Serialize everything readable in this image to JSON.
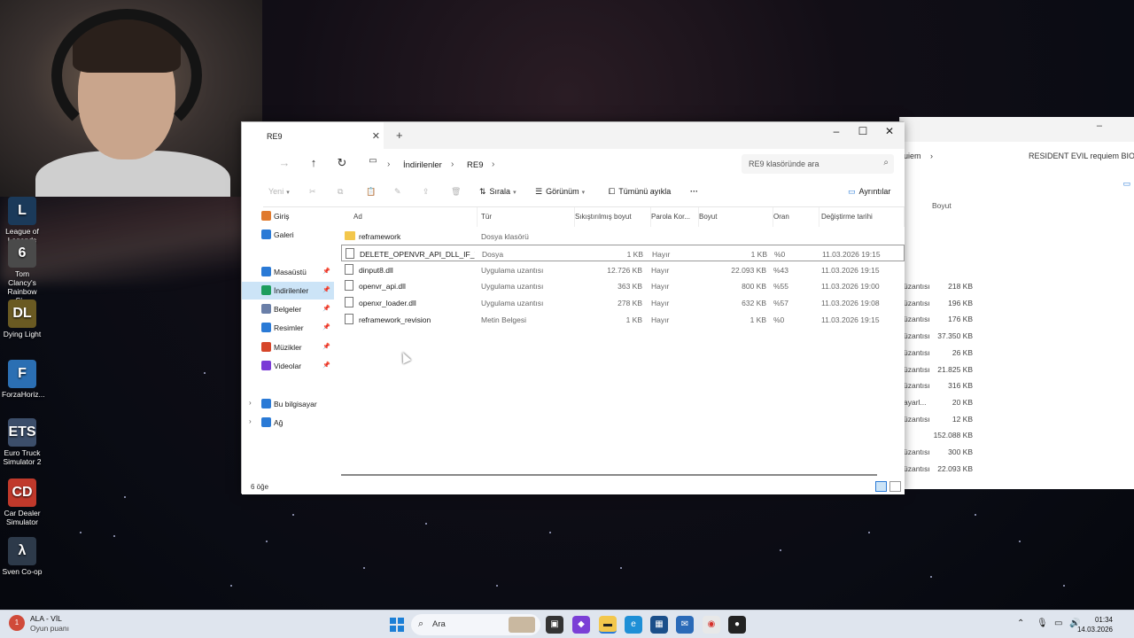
{
  "desktop": {
    "icons": [
      {
        "label": "League of Legends",
        "icon": "league-of-legends-icon",
        "color": "#1b3a5a",
        "glyph": "L"
      },
      {
        "label": "Tom Clancy's Rainbow Si...",
        "icon": "rainbow-six-icon",
        "color": "#4a4a4a",
        "glyph": "6"
      },
      {
        "label": "Dying Light",
        "icon": "dying-light-icon",
        "color": "#6a5a22",
        "glyph": "DL"
      },
      {
        "label": "ForzaHoriz...",
        "icon": "forza-horizon-icon",
        "color": "#2b6fb3",
        "glyph": "F"
      },
      {
        "label": "Euro Truck Simulator 2",
        "icon": "euro-truck-icon",
        "color": "#3c4e6a",
        "glyph": "ETS"
      },
      {
        "label": "Car Dealer Simulator",
        "icon": "car-dealer-icon",
        "color": "#c0392b",
        "glyph": "CD"
      },
      {
        "label": "Sven Co-op",
        "icon": "sven-coop-icon",
        "color": "#2d3a4a",
        "glyph": "λ"
      }
    ]
  },
  "bg_window": {
    "breadcrumb_tail": "uiem",
    "breadcrumb_next": "RESIDENT EVIL requiem BIOH",
    "col_size": "Boyut",
    "rows": [
      {
        "type": "üzantısı",
        "size": "218 KB"
      },
      {
        "type": "üzantısı",
        "size": "196 KB"
      },
      {
        "type": "üzantısı",
        "size": "176 KB"
      },
      {
        "type": "üzantısı",
        "size": "37.350 KB"
      },
      {
        "type": "üzantısı",
        "size": "26 KB"
      },
      {
        "type": "üzantısı",
        "size": "21.825 KB"
      },
      {
        "type": "üzantısı",
        "size": "316 KB"
      },
      {
        "type": "ayarl...",
        "size": "20 KB"
      },
      {
        "type": "üzantısı",
        "size": "12 KB"
      },
      {
        "type": "",
        "size": "152.088 KB"
      },
      {
        "type": "üzantısı",
        "size": "300 KB"
      },
      {
        "type": "üzantısı",
        "size": "22.093 KB"
      }
    ]
  },
  "explorer": {
    "tab_title": "RE9",
    "new_tab": "+",
    "breadcrumb": [
      "İndirilenler",
      "RE9"
    ],
    "search_placeholder": "RE9 klasöründe ara",
    "toolbar": {
      "new": "Yeni",
      "sort": "Sırala",
      "view": "Görünüm",
      "select_none": "Tümünü ayıkla",
      "more": "···",
      "details": "Ayrıntılar"
    },
    "sidebar": [
      {
        "label": "Giriş",
        "icon": "home-icon",
        "color": "#e07a2e",
        "pinned": false
      },
      {
        "label": "Galeri",
        "icon": "gallery-icon",
        "color": "#2a7ad6",
        "pinned": false
      },
      {
        "label": "Masaüstü",
        "icon": "desktop-icon",
        "color": "#2a7ad6",
        "pinned": true
      },
      {
        "label": "İndirilenler",
        "icon": "downloads-icon",
        "color": "#1e9e5e",
        "pinned": true,
        "selected": true
      },
      {
        "label": "Belgeler",
        "icon": "documents-icon",
        "color": "#6a7fa8",
        "pinned": true
      },
      {
        "label": "Resimler",
        "icon": "pictures-icon",
        "color": "#2a7ad6",
        "pinned": true
      },
      {
        "label": "Müzikler",
        "icon": "music-icon",
        "color": "#d6462a",
        "pinned": true
      },
      {
        "label": "Videolar",
        "icon": "videos-icon",
        "color": "#7a3ad6",
        "pinned": true
      },
      {
        "label": "Bu bilgisayar",
        "icon": "this-pc-icon",
        "color": "#2a7ad6",
        "pinned": false
      },
      {
        "label": "Ağ",
        "icon": "network-icon",
        "color": "#2a7ad6",
        "pinned": false
      }
    ],
    "columns": [
      "Ad",
      "Tür",
      "Sıkıştırılmış boyut",
      "Parola Kor...",
      "Boyut",
      "Oran",
      "Değiştirme tarihi"
    ],
    "files": [
      {
        "name": "reframework",
        "type": "Dosya klasörü",
        "compressed": "",
        "password": "",
        "size": "",
        "ratio": "",
        "modified": "",
        "kind": "folder"
      },
      {
        "name": "DELETE_OPENVR_API_DLL_IF_YOU_...",
        "type": "Dosya",
        "compressed": "1 KB",
        "password": "Hayır",
        "size": "1 KB",
        "ratio": "%0",
        "modified": "11.03.2026 19:15",
        "kind": "file",
        "selected": true
      },
      {
        "name": "dinput8.dll",
        "type": "Uygulama uzantısı",
        "compressed": "12.726 KB",
        "password": "Hayır",
        "size": "22.093 KB",
        "ratio": "%43",
        "modified": "11.03.2026 19:15",
        "kind": "file"
      },
      {
        "name": "openvr_api.dll",
        "type": "Uygulama uzantısı",
        "compressed": "363 KB",
        "password": "Hayır",
        "size": "800 KB",
        "ratio": "%55",
        "modified": "11.03.2026 19:00",
        "kind": "file"
      },
      {
        "name": "openxr_loader.dll",
        "type": "Uygulama uzantısı",
        "compressed": "278 KB",
        "password": "Hayır",
        "size": "632 KB",
        "ratio": "%57",
        "modified": "11.03.2026 19:08",
        "kind": "file"
      },
      {
        "name": "reframework_revision",
        "type": "Metin Belgesi",
        "compressed": "1 KB",
        "password": "Hayır",
        "size": "1 KB",
        "ratio": "%0",
        "modified": "11.03.2026 19:15",
        "kind": "file"
      }
    ],
    "status": "6 öğe"
  },
  "taskbar": {
    "weather_badge": "1",
    "weather_title": "ALA - VİL",
    "weather_sub": "Oyun puanı",
    "search_label": "Ara",
    "time": "01:34",
    "date": "14.03.2026"
  }
}
